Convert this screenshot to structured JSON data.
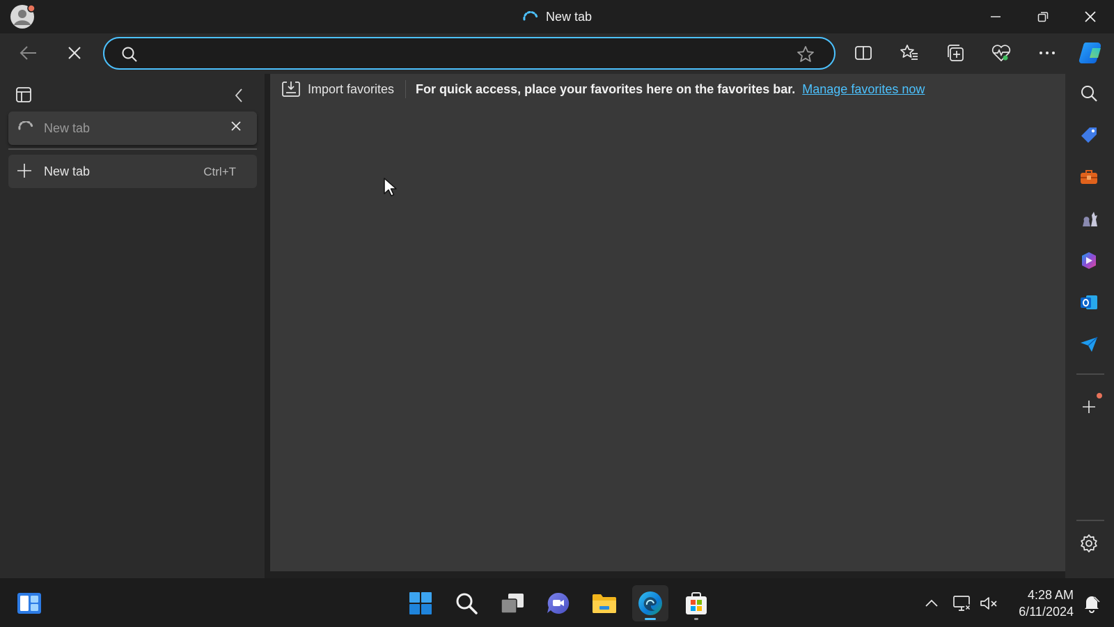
{
  "window": {
    "title": "New tab"
  },
  "toolbar": {
    "address_value": "",
    "address_placeholder": ""
  },
  "vertical_tabs": {
    "tabs": [
      {
        "label": "New tab"
      }
    ],
    "new_tab": {
      "label": "New tab",
      "shortcut": "Ctrl+T"
    }
  },
  "favorites_bar": {
    "import_label": "Import favorites",
    "message": "For quick access, place your favorites here on the favorites bar.",
    "manage_link": "Manage favorites now"
  },
  "right_sidebar": {
    "items": [
      "search-icon",
      "shopping-tag-icon",
      "tools-icon",
      "games-icon",
      "copilot-icon",
      "outlook-icon",
      "send-icon",
      "add-icon",
      "settings-icon"
    ]
  },
  "taskbar": {
    "pinned": [
      "start-icon",
      "search-icon",
      "task-view-icon",
      "teams-icon",
      "file-explorer-icon",
      "edge-icon",
      "store-icon"
    ],
    "time": "4:28 AM",
    "date": "6/11/2024"
  },
  "colors": {
    "accent": "#4cc2ff",
    "titlebar": "#1f1f1f",
    "toolbar": "#2b2b2b",
    "content": "#393939"
  }
}
